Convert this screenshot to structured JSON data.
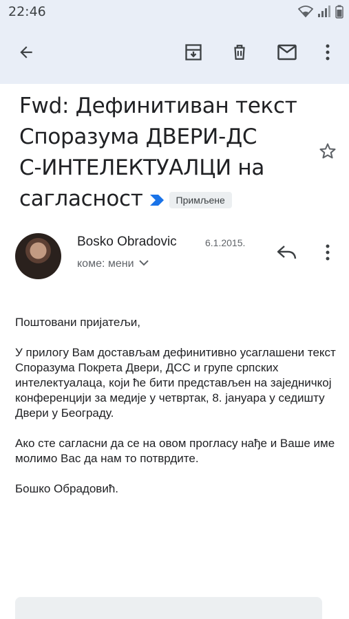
{
  "status_bar": {
    "time": "22:46"
  },
  "toolbar": {
    "back_icon": "arrow-left-icon",
    "archive_icon": "archive-icon",
    "delete_icon": "trash-icon",
    "mark_unread_icon": "mail-icon",
    "more_icon": "more-vertical-icon"
  },
  "email": {
    "subject": "Fwd: Дефинитиван текст Споразума ДВЕРИ-ДСС-ИНТЕЛЕКТУАЛЦИ на сагласност",
    "subject_lines": [
      "Fwd: Дефинитиван текст",
      "Споразума ДВЕРИ-ДС",
      "С-ИНТЕЛЕКТУАЛЦИ на",
      "сагласност"
    ],
    "label": "Примљене",
    "sender_name": "Bosko Obradovic",
    "date": "6.1.2015.",
    "recipients": "коме: мени",
    "body": [
      "Поштовани пријатељи,",
      "У прилогу Вам достављам дефинитивно усаглашени текст Споразума Покрета Двери, ДСС и групе српских интелектуалаца, који ће бити представљен на заједничкој конференцији за медије у четвртак, 8. јануара у седишту Двери у Београду.",
      "Ако сте сагласни да се на овом прогласу нађе и Ваше име молимо Вас да нам то потврдите.",
      "Бошко Обрадовић."
    ]
  },
  "colors": {
    "app_bar_bg": "#e9eef7",
    "label_chip_bg": "#eceff1",
    "importance_marker": "#1a73e8",
    "text_primary": "#202124",
    "text_secondary": "#5f6368"
  }
}
